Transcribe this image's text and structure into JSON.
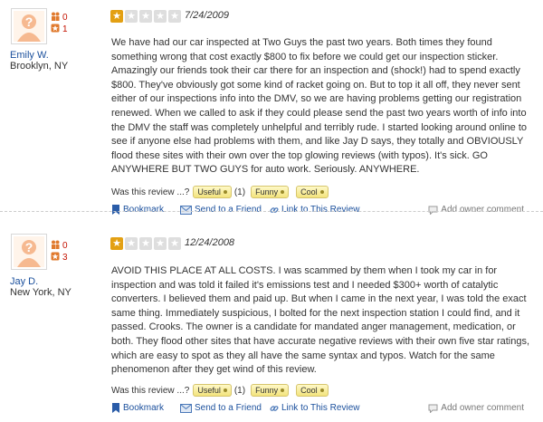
{
  "reviews": [
    {
      "user": {
        "name": "Emily W.",
        "location": "Brooklyn, NY",
        "friend_count": "0",
        "review_count": "1"
      },
      "rating": 1,
      "date": "7/24/2009",
      "text": "We have had our car inspected at Two Guys the past two years. Both times they found something wrong that cost exactly $800 to fix before we could get our inspection sticker. Amazingly our friends took their car there for an inspection and (shock!) had to spend exactly $800. They've obviously got some kind of racket going on. But to top it all off, they never sent either of our inspections info into the DMV, so we are having problems getting our registration renewed. When we called to ask if they could please send the past two years worth of info into the DMV the staff was completely unhelpful and terribly rude. I started looking around online to see if anyone else had problems with them, and like Jay D says, they totally and OBVIOUSLY flood these sites with their own over the top glowing reviews (with typos). It's sick. GO ANYWHERE BUT TWO GUYS for auto work. Seriously. ANYWHERE.",
      "votes": {
        "prompt": "Was this review ...?",
        "useful_label": "Useful",
        "useful_count": "(1)",
        "funny_label": "Funny",
        "cool_label": "Cool"
      }
    },
    {
      "user": {
        "name": "Jay D.",
        "location": "New York, NY",
        "friend_count": "0",
        "review_count": "3"
      },
      "rating": 1,
      "date": "12/24/2008",
      "text": "AVOID THIS PLACE AT ALL COSTS. I was scammed by them when I took my car in for inspection and was told it failed it's emissions test and I needed $300+ worth of catalytic converters. I believed them and paid up. But when I came in the next year, I was told the exact same thing. Immediately suspicious, I bolted for the next inspection station I could find, and it passed. Crooks. The owner is a candidate for mandated anger management, medication, or both. They flood other sites that have accurate negative reviews with their own five star ratings, which are easy to spot as they all have the same syntax and typos. Watch for the same phenomenon after they get wind of this review.",
      "votes": {
        "prompt": "Was this review ...?",
        "useful_label": "Useful",
        "useful_count": "(1)",
        "funny_label": "Funny",
        "cool_label": "Cool"
      }
    }
  ],
  "actions": {
    "bookmark": "Bookmark",
    "send_to_friend": "Send to a Friend",
    "link_to_review": "Link to This Review",
    "add_owner_comment": "Add owner comment"
  },
  "colors": {
    "link": "#1a4f9c",
    "star_filled": "#e3a013",
    "star_empty": "#dedede",
    "stat_red": "#c41200",
    "vote_button": "#f3e37c"
  },
  "icons": [
    "avatar-placeholder-icon",
    "friends-icon",
    "reviews-icon",
    "star-icon",
    "bookmark-icon",
    "send-icon",
    "link-icon",
    "comment-icon"
  ]
}
